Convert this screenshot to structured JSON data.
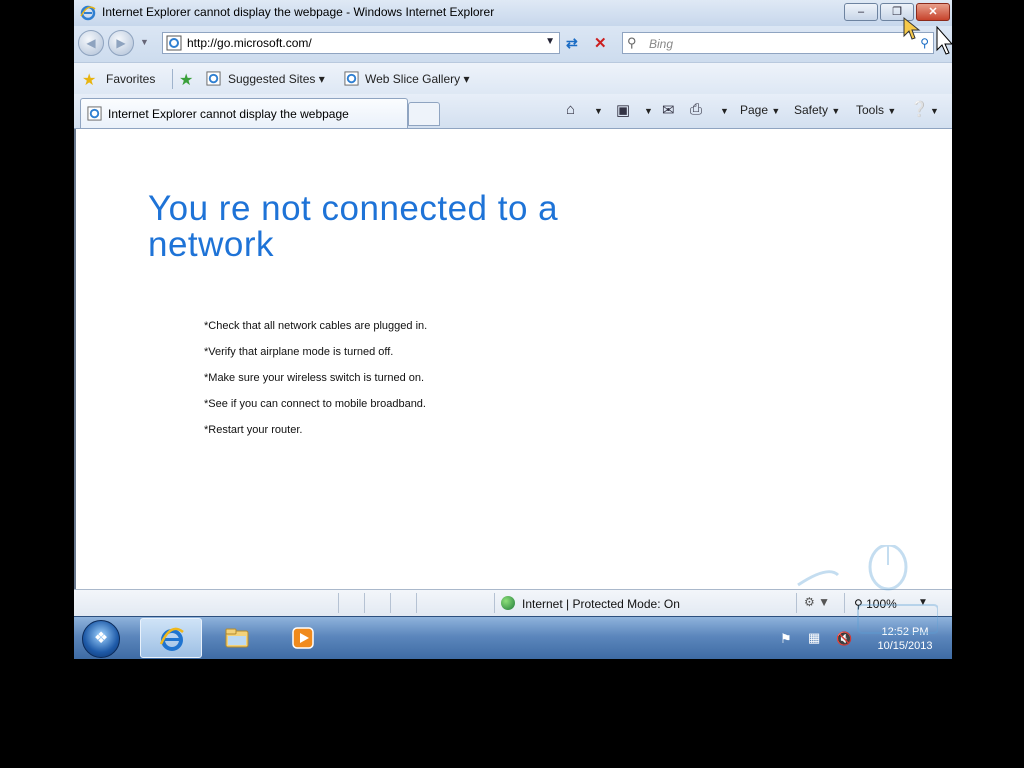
{
  "window": {
    "title": "Internet Explorer cannot display the webpage - Windows Internet Explorer",
    "min_label": "–",
    "max_label": "❐",
    "close_label": "✕"
  },
  "address_bar": {
    "url": "http://go.microsoft.com/",
    "search_placeholder": "Bing"
  },
  "favorites_bar": {
    "favorites_label": "Favorites",
    "items": [
      {
        "label": "Suggested Sites ▾"
      },
      {
        "label": "Web Slice Gallery ▾"
      }
    ]
  },
  "tab": {
    "title": "Internet Explorer cannot display the webpage"
  },
  "command_bar": {
    "page_label": "Page",
    "safety_label": "Safety",
    "tools_label": "Tools"
  },
  "error_page": {
    "title": "You re not connected to a network",
    "tips": [
      "*Check that all network cables are plugged in.",
      "*Verify that airplane mode is turned off.",
      "*Make sure your wireless switch is turned on.",
      "*See if you can connect to mobile broadband.",
      "*Restart your router."
    ]
  },
  "status_bar": {
    "zone": "Internet | Protected Mode: On",
    "zoom": "100%"
  },
  "taskbar": {
    "clock_time": "12:52 PM",
    "clock_date": "10/15/2013",
    "accent": "#3d6aa3"
  },
  "colors": {
    "error_title": "#1e73d7",
    "close_button": "#c7432c"
  }
}
